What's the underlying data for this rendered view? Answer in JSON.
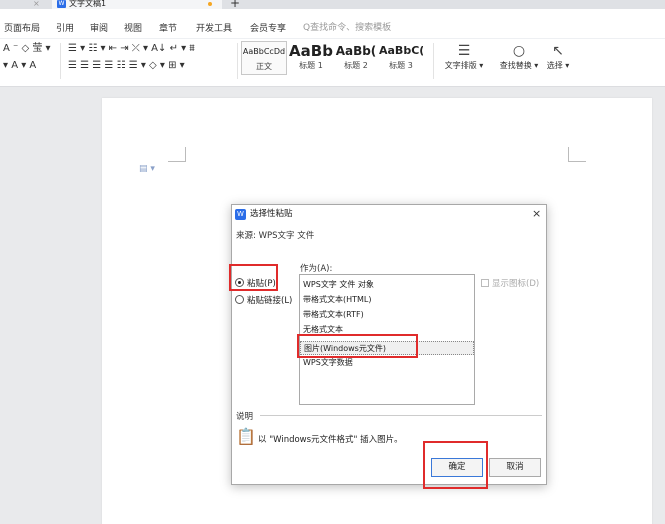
{
  "tabbar": {
    "closed_tab_x": "×",
    "doc_logo": "W",
    "doc_title": "文字文稿1",
    "new_tab": "+"
  },
  "menu": {
    "items": [
      "页面布局",
      "引用",
      "审阅",
      "视图",
      "章节",
      "开发工具",
      "会员专享"
    ],
    "search": "Q查找命令、搜索模板"
  },
  "toolbar": {
    "row1": [
      "A ⁻ ◇ 莹 ▾",
      "☰ ▾ ☷ ▾ ⇤ ⇥ ⤫ ▾ A↓ ↵ ▾ ⩩"
    ],
    "row2": [
      "▾ A ▾ A",
      "☰ ☰ ☰ ☰ ☷ ☰ ▾ ◇ ▾ ⊞ ▾"
    ],
    "styles": [
      {
        "sample": "AaBbCcDd",
        "label": "正文"
      },
      {
        "sample": "AaBb",
        "label": "标题 1"
      },
      {
        "sample": "AaBb(",
        "label": "标题 2"
      },
      {
        "sample": "AaBbC(",
        "label": "标题 3"
      }
    ],
    "layout_label": "文字排版 ▾",
    "find_label": "查找替换 ▾",
    "select_label": "选择 ▾"
  },
  "dialog": {
    "logo": "W",
    "title": "选择性粘贴",
    "close": "×",
    "source": "来源: WPS文字 文件",
    "as_label": "作为(A):",
    "paste_label": "粘贴(P)",
    "paste_link_label": "粘贴链接(L)",
    "formats": [
      "WPS文字 文件 对象",
      "带格式文本(HTML)",
      "带格式文本(RTF)",
      "无格式文本",
      "图片(Windows元文件)",
      "WPS文字数据"
    ],
    "selected_format_index": 4,
    "display_icon_label": "显示图标(D)",
    "explain_label": "说明",
    "result_text": "以 \"Windows元文件格式\" 插入图片。",
    "ok": "确定",
    "cancel": "取消"
  },
  "colors": {
    "accent": "#2b6de8",
    "highlight": "#e02b2b",
    "background": "#e9eaec"
  }
}
